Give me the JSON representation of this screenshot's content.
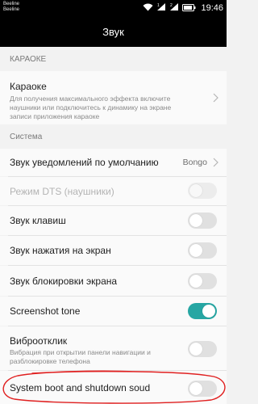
{
  "status_bar": {
    "carrier_1": "Beeline",
    "carrier_2": "Beeline",
    "time": "19:46"
  },
  "header": {
    "title": "Звук"
  },
  "sections": {
    "karaoke": {
      "label": "КАРАОКЕ"
    },
    "system": {
      "label": "Система"
    }
  },
  "rows": {
    "karaoke": {
      "title": "Караоке",
      "subtitle": "Для получения максимального эффекта включите наушники или подключитесь к динамику на экране записи приложения караоке"
    },
    "notification_sound": {
      "title": "Звук уведомлений по умолчанию",
      "value": "Bongo"
    },
    "dts": {
      "title": "Режим DTS (наушники)",
      "enabled": false,
      "on": false
    },
    "keypad": {
      "title": "Звук клавиш",
      "on": false
    },
    "touch": {
      "title": "Звук нажатия на экран",
      "on": false
    },
    "lock": {
      "title": "Звук блокировки экрана",
      "on": false
    },
    "screenshot": {
      "title": "Screenshot tone",
      "on": true
    },
    "vibration": {
      "title": "Виброотклик",
      "subtitle": "Вибрация при открытии панели навигации и разблокировке телефона",
      "on": false
    },
    "boot": {
      "title": "System boot and shutdown soud",
      "on": false
    }
  },
  "colors": {
    "accent": "#26a6a3",
    "annotation": "#e02020",
    "toggle_off": "#e0e0e0"
  }
}
